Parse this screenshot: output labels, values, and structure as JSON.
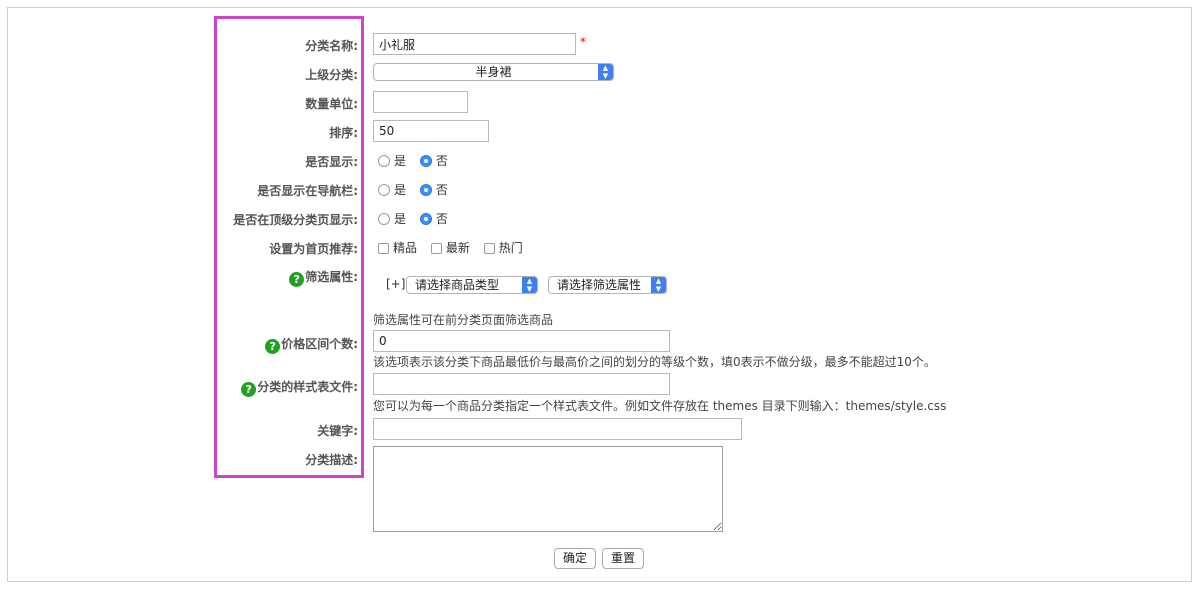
{
  "form": {
    "name_label": "分类名称:",
    "name_value": "小礼服",
    "required_mark": "*",
    "parent_label": "上级分类:",
    "parent_value": "半身裙",
    "unit_label": "数量单位:",
    "unit_value": "",
    "sort_label": "排序:",
    "sort_value": "50",
    "show_label": "是否显示:",
    "show_nav_label": "是否显示在导航栏:",
    "show_top_label": "是否在顶级分类页显示:",
    "yes": "是",
    "no": "否",
    "recommend_label": "设置为首页推荐:",
    "recommend_options": [
      "精品",
      "最新",
      "热门"
    ],
    "filter_label": "筛选属性:",
    "filter_add": "[+]",
    "filter_type_select": "请选择商品类型",
    "filter_attr_select": "请选择筛选属性",
    "filter_note": "筛选属性可在前分类页面筛选商品",
    "price_label": "价格区间个数:",
    "price_value": "0",
    "price_note": "该选项表示该分类下商品最低价与最高价之间的划分的等级个数，填0表示不做分级，最多不能超过10个。",
    "style_label": "分类的样式表文件:",
    "style_value": "",
    "style_note": "您可以为每一个商品分类指定一个样式表文件。例如文件存放在 themes 目录下则输入：themes/style.css",
    "keywords_label": "关键字:",
    "keywords_value": "",
    "desc_label": "分类描述:",
    "desc_value": "",
    "help_icon": "?",
    "submit": "确定",
    "reset": "重置"
  },
  "colors": {
    "highlight_border": "#cc44cc",
    "help_icon_bg": "#21a121",
    "select_arrow_bg": "#3f7ff2",
    "radio_selected": "#3d8ef5"
  }
}
